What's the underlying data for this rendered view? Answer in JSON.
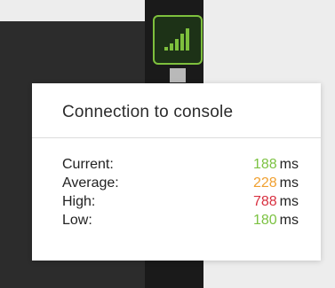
{
  "popover": {
    "title": "Connection to console",
    "stats": [
      {
        "label": "Current:",
        "value": "188",
        "unit": "ms",
        "color": "#7cc242"
      },
      {
        "label": "Average:",
        "value": "228",
        "unit": "ms",
        "color": "#f0a030"
      },
      {
        "label": "High:",
        "value": "788",
        "unit": "ms",
        "color": "#d83040"
      },
      {
        "label": "Low:",
        "value": "180",
        "unit": "ms",
        "color": "#7cc242"
      }
    ]
  },
  "signal_button": {
    "icon": "signal-strength-icon",
    "accent": "#7ec03d"
  }
}
